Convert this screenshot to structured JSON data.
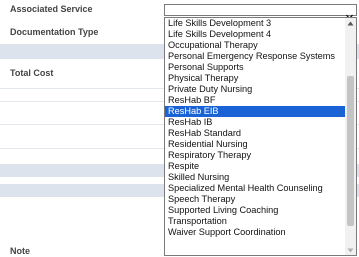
{
  "form": {
    "associated_service_label": "Associated Service",
    "documentation_type_label": "Documentation Type",
    "total_cost_label": "Total Cost",
    "note_label": "Note"
  },
  "select": {
    "value": "",
    "options": [
      "Life Skills Development 3",
      "Life Skills Development 4",
      "Occupational Therapy",
      "Personal Emergency Response Systems",
      "Personal Supports",
      "Physical Therapy",
      "Private Duty Nursing",
      "ResHab BF",
      "ResHab EIB",
      "ResHab IB",
      "ResHab Standard",
      "Residential Nursing",
      "Respiratory Therapy",
      "Respite",
      "Skilled Nursing",
      "Specialized Mental Health Counseling",
      "Speech Therapy",
      "Supported Living Coaching",
      "Transportation",
      "Waiver Support Coordination"
    ],
    "selected_option": "ResHab EIB",
    "scroll_position_fraction": 0.72
  },
  "colors": {
    "highlight": "#1a63d6",
    "band": "#dde3ec"
  }
}
